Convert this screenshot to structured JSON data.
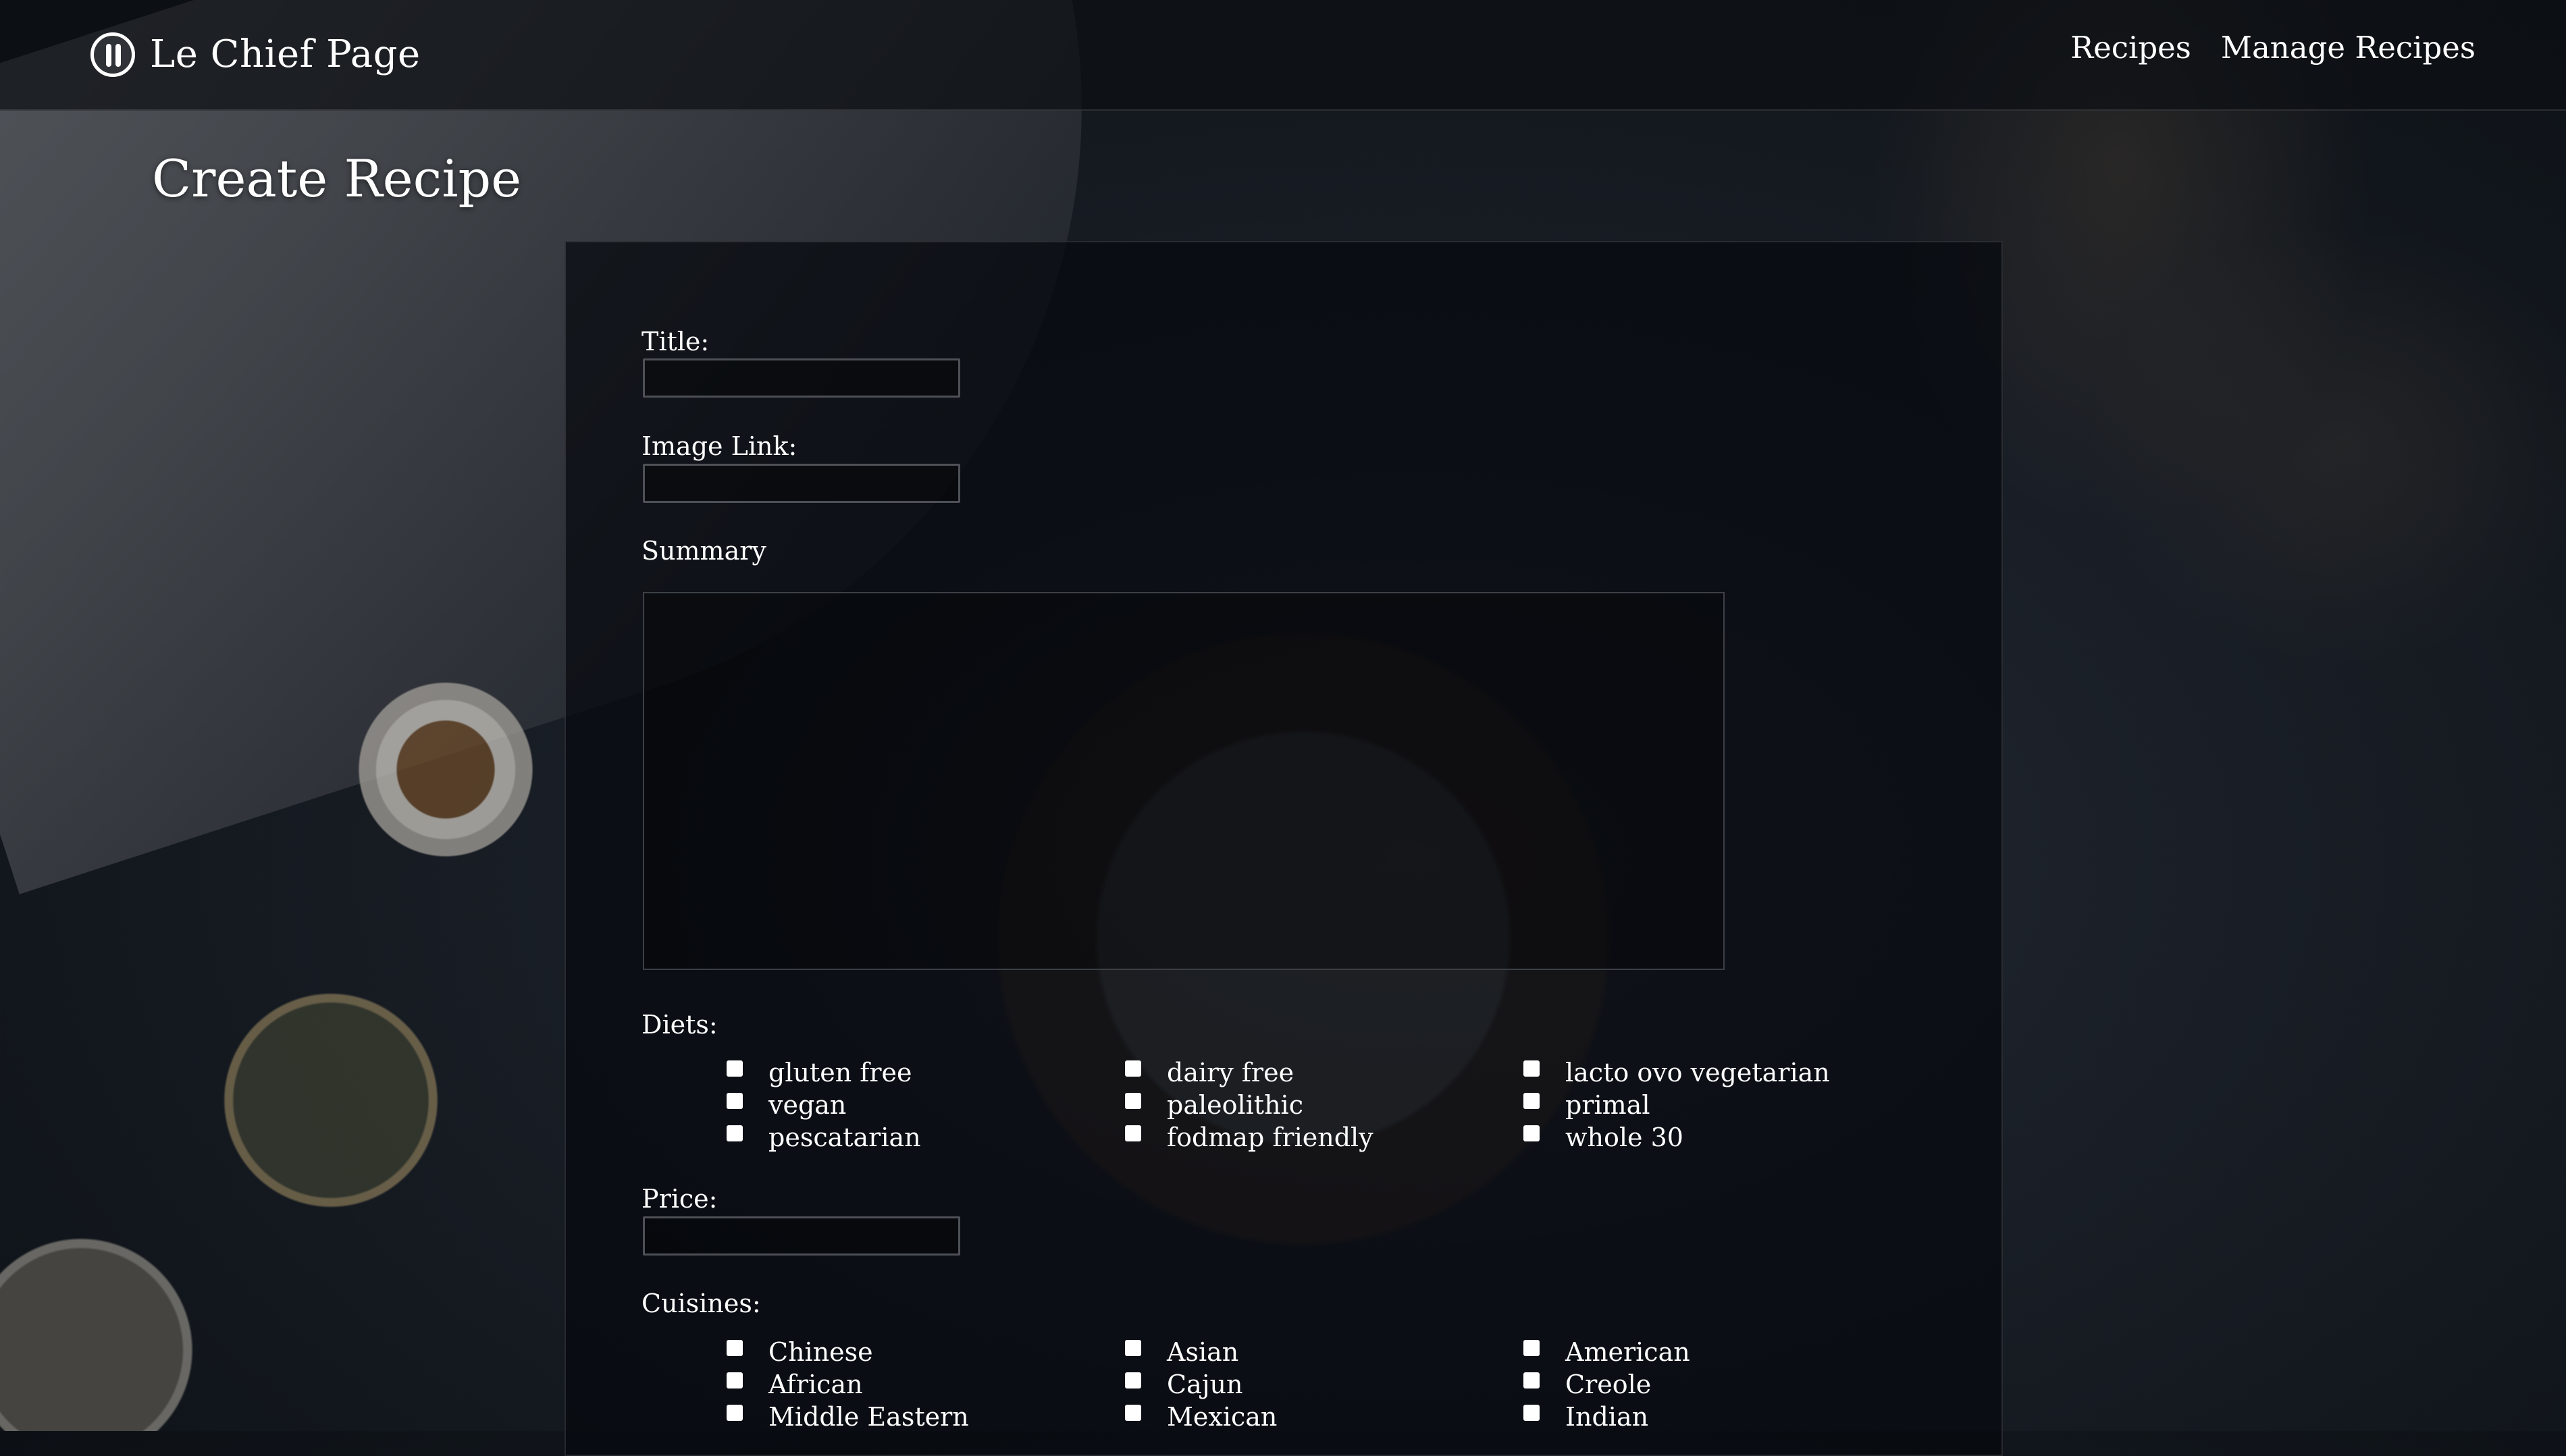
{
  "brand": {
    "title": "Le Chief Page",
    "icon": "fork-knife-plate-icon"
  },
  "nav": {
    "links": [
      "Recipes",
      "Manage Recipes"
    ]
  },
  "page": {
    "title": "Create Recipe"
  },
  "form": {
    "title_label": "Title:",
    "title_value": "",
    "image_label": "Image Link:",
    "image_value": "",
    "summary_label": "Summary",
    "summary_value": "",
    "diets_label": "Diets:",
    "diets": [
      "gluten free",
      "dairy free",
      "lacto ovo vegetarian",
      "vegan",
      "paleolithic",
      "primal",
      "pescatarian",
      "fodmap friendly",
      "whole 30"
    ],
    "price_label": "Price:",
    "price_value": "",
    "cuisines_label": "Cuisines:",
    "cuisines": [
      "Chinese",
      "Asian",
      "American",
      "African",
      "Cajun",
      "Creole",
      "Middle Eastern",
      "Mexican",
      "Indian"
    ]
  },
  "colors": {
    "navbar_bg": "#0c0f14",
    "panel_bg": "#06090e",
    "text": "#ffffff",
    "input_border": "#4d5157"
  }
}
